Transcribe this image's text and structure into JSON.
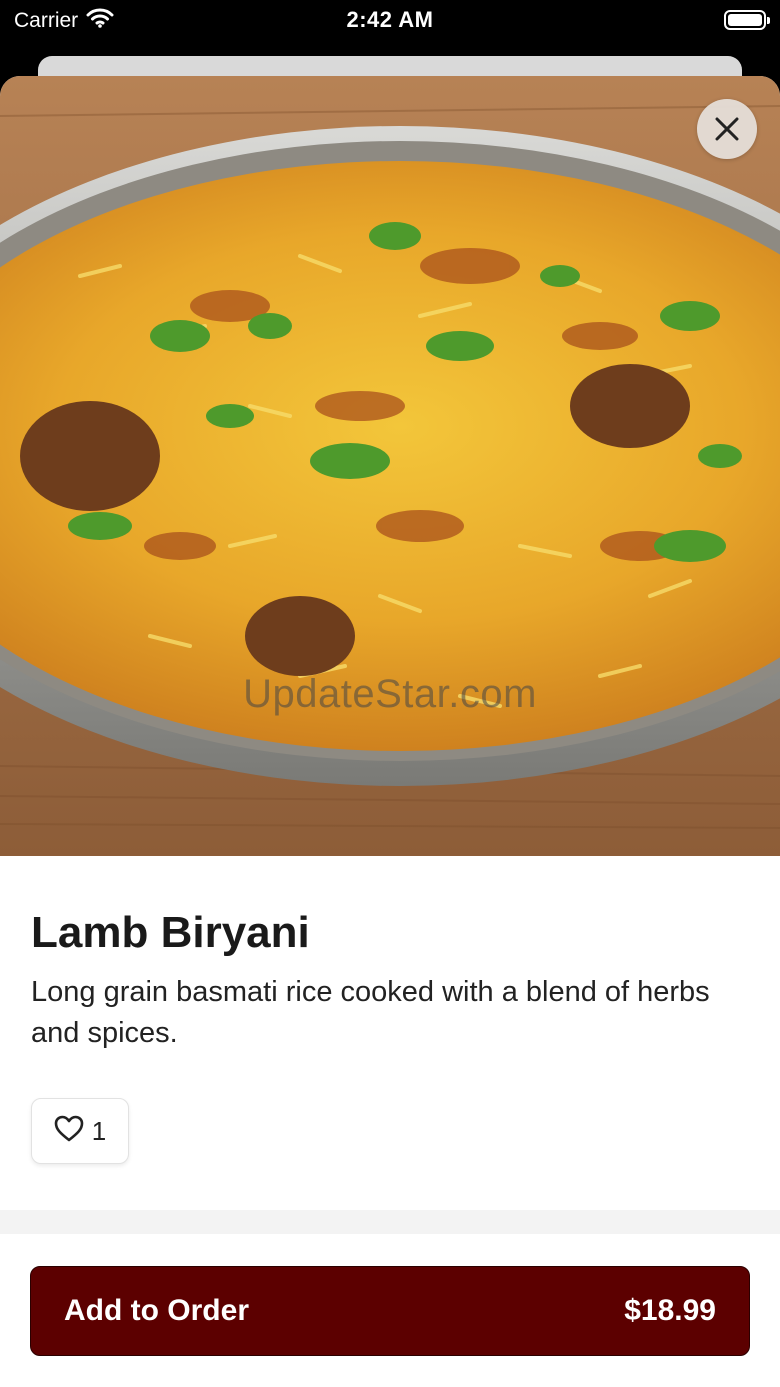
{
  "status_bar": {
    "carrier": "Carrier",
    "time": "2:42 AM"
  },
  "item": {
    "name": "Lamb Biryani",
    "description": "Long grain basmati rice cooked with a blend of herbs and spices.",
    "likes": "1",
    "image_subject": "lamb biryani in a steel bowl",
    "watermark": "UpdateStar.com"
  },
  "order": {
    "label": "Add to Order",
    "price": "$18.99"
  },
  "colors": {
    "accent": "#5c0000"
  },
  "icons": {
    "close": "close-icon",
    "like": "heart-icon",
    "wifi": "wifi-icon",
    "battery": "battery-icon"
  }
}
